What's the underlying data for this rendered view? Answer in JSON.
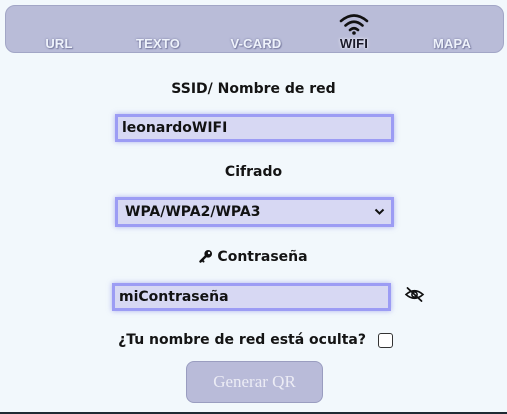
{
  "tabs": [
    {
      "label": "URL",
      "active": false
    },
    {
      "label": "TEXTO",
      "active": false
    },
    {
      "label": "V-CARD",
      "active": false
    },
    {
      "label": "WIFI",
      "active": true,
      "icon": "wifi-icon"
    },
    {
      "label": "MAPA",
      "active": false
    }
  ],
  "form": {
    "ssid_label": "SSID/ Nombre de red",
    "ssid_value": "leonardoWIFI",
    "cipher_label": "Cifrado",
    "cipher_value": "WPA/WPA2/WPA3",
    "password_label": "Contraseña",
    "password_icon": "key-icon",
    "password_value": "miContraseña",
    "toggle_visibility_icon": "eye-slash-icon",
    "hidden_network_label": "¿Tu nombre de red está oculta?",
    "hidden_network_checked": false,
    "generate_button": "Generar QR"
  },
  "colors": {
    "tabbar_bg": "#b9bcd8",
    "field_bg": "#d7d8f3",
    "field_border": "#9c9cf4",
    "page_bg": "#f2f8fc",
    "button_bg": "#b9bbd9"
  }
}
